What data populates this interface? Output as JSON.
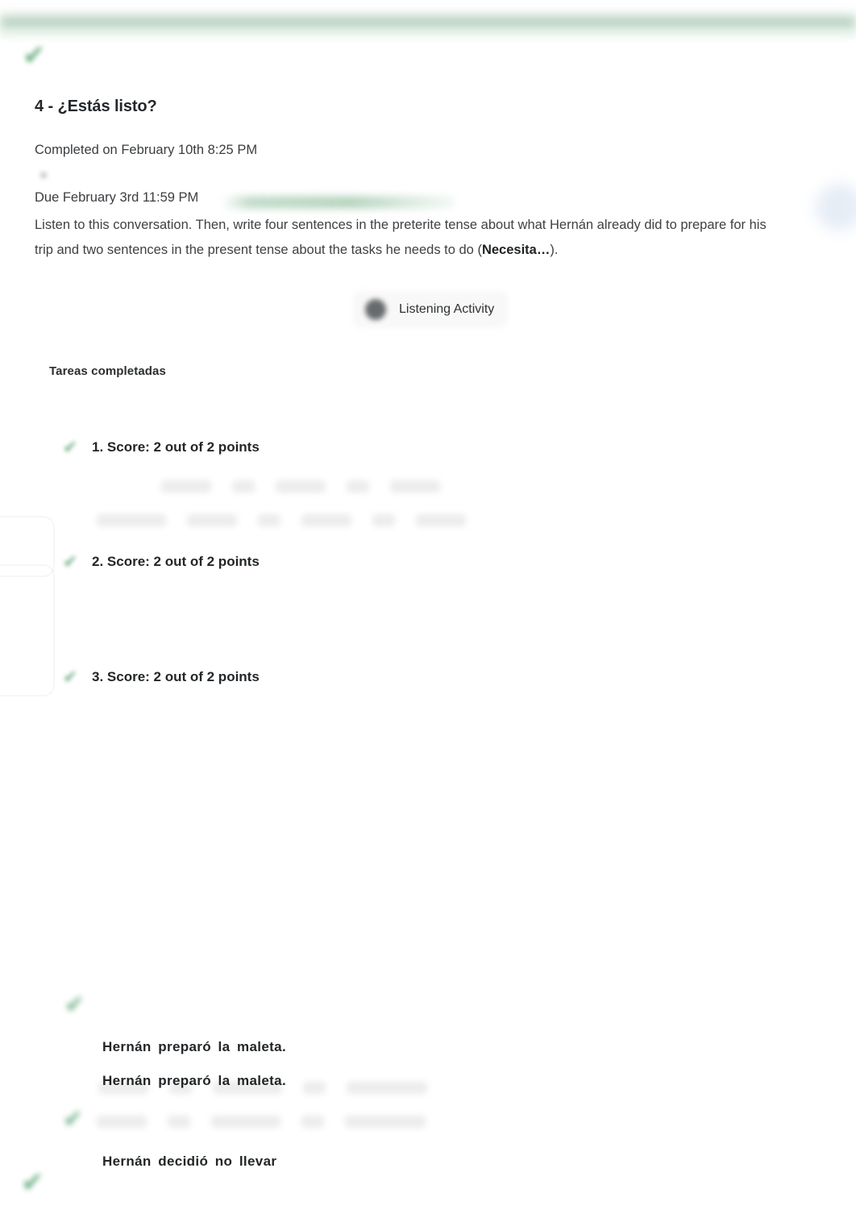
{
  "header": {
    "top_bar_color": "#98bea3",
    "status_icon": "checkmark-icon"
  },
  "assignment": {
    "title": "4 - ¿Estás listo?",
    "completed_on": "Completed on February 10th 8:25 PM",
    "due_on": "Due February 3rd 11:59 PM",
    "prompt_before_bold": "Listen to this conversation. Then, write four sentences in the preterite tense about what Hernán already did to prepare for his trip and two sentences in the present tense about the tasks he needs to do (",
    "prompt_bold": "Necesita…",
    "prompt_after_bold": ")."
  },
  "listening_activity": {
    "label": "Listening Activity",
    "icon": "audio-speaker-icon"
  },
  "tasks_section": {
    "heading": "Tareas completadas",
    "items": [
      {
        "icon": "green-check-icon",
        "label": "1. Score: 2 out of 2 points"
      },
      {
        "icon": "green-check-icon",
        "label": "2. Score: 2 out of 2 points"
      },
      {
        "icon": "green-check-icon",
        "label": "3. Score: 2 out of 2 points"
      }
    ]
  },
  "answers": [
    {
      "text": "Hernán  preparó  la  maleta."
    },
    {
      "text": "Hernán  preparó  la  maleta."
    },
    {
      "text": "Hernán  decidió  no  llevar"
    }
  ],
  "colors": {
    "accent_green": "#55a06f",
    "top_bar_green": "#98bea3",
    "text_primary": "#232628",
    "text_secondary": "#3e4144"
  }
}
